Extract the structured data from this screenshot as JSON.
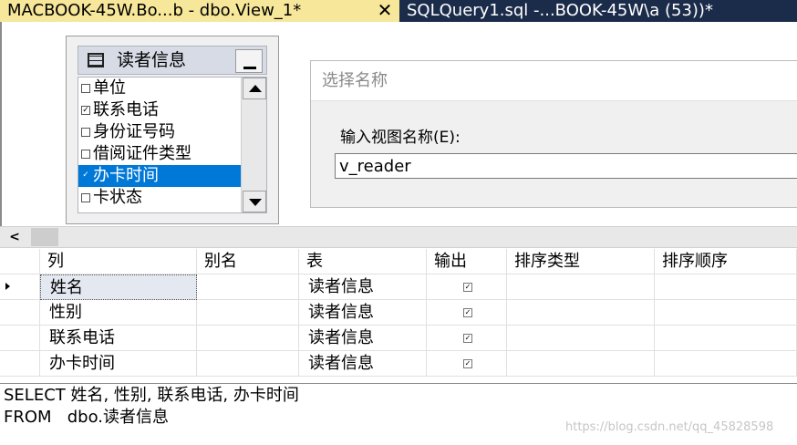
{
  "tabs": [
    {
      "label": "MACBOOK-45W.Bo...b - dbo.View_1*",
      "active": true,
      "close_glyph": "✕"
    },
    {
      "label": "SQLQuery1.sql -...BOOK-45W\\a (53))*",
      "active": false
    }
  ],
  "diagram": {
    "table": {
      "title": "读者信息",
      "icon": "table-grid-icon",
      "columns": [
        {
          "label": "单位",
          "checked": false,
          "selected": false
        },
        {
          "label": "联系电话",
          "checked": true,
          "selected": false
        },
        {
          "label": "身份证号码",
          "checked": false,
          "selected": false
        },
        {
          "label": "借阅证件类型",
          "checked": false,
          "selected": false
        },
        {
          "label": "办卡时间",
          "checked": true,
          "selected": true
        },
        {
          "label": "卡状态",
          "checked": false,
          "selected": false
        }
      ]
    }
  },
  "name_dialog": {
    "title": "选择名称",
    "label": "输入视图名称(E):",
    "input_value": "v_reader"
  },
  "hscroll": {
    "left_glyph": "<"
  },
  "grid": {
    "headers": [
      "列",
      "别名",
      "表",
      "输出",
      "排序类型",
      "排序顺序"
    ],
    "rows": [
      {
        "column": "姓名",
        "alias": "",
        "table": "读者信息",
        "output": true,
        "sort_type": "",
        "sort_order": ""
      },
      {
        "column": "性别",
        "alias": "",
        "table": "读者信息",
        "output": true,
        "sort_type": "",
        "sort_order": ""
      },
      {
        "column": "联系电话",
        "alias": "",
        "table": "读者信息",
        "output": true,
        "sort_type": "",
        "sort_order": ""
      },
      {
        "column": "办卡时间",
        "alias": "",
        "table": "读者信息",
        "output": true,
        "sort_type": "",
        "sort_order": ""
      }
    ]
  },
  "sql": {
    "line1": "SELECT 姓名, 性别, 联系电话, 办卡时间",
    "line2": "FROM   dbo.读者信息"
  },
  "watermark": "https://blog.csdn.net/qq_45828598",
  "colors": {
    "tab_strip": "#1b2b4a",
    "active_tab": "#f7e79a",
    "selection": "#0078d7"
  }
}
